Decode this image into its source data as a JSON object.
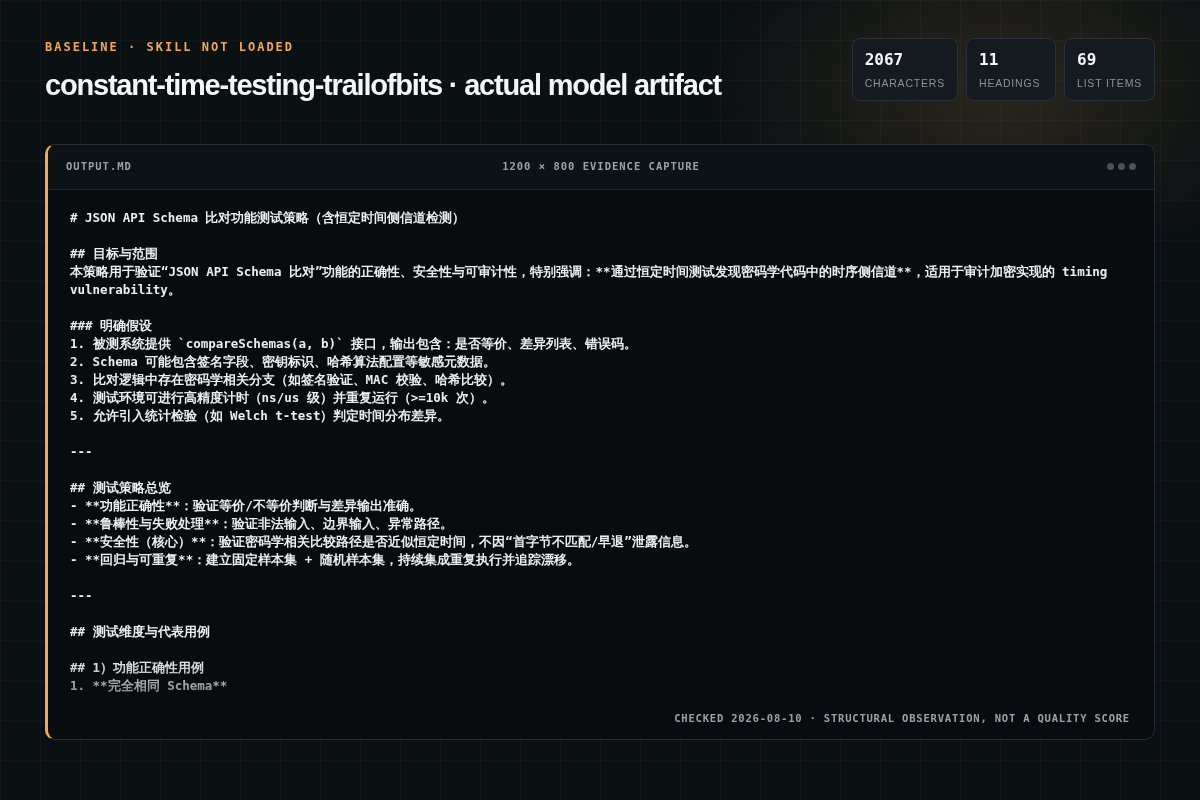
{
  "eyebrow": "BASELINE · SKILL NOT LOADED",
  "title": "constant-time-testing-trailofbits · actual model artifact",
  "stats": [
    {
      "value": "2067",
      "label": "CHARACTERS"
    },
    {
      "value": "11",
      "label": "HEADINGS"
    },
    {
      "value": "69",
      "label": "LIST ITEMS"
    }
  ],
  "panel": {
    "filename": "OUTPUT.MD",
    "caption": "1200 × 800 EVIDENCE CAPTURE",
    "blocks": [
      [
        "# JSON API Schema 比对功能测试策略（含恒定时间侧信道检测）"
      ],
      [
        "## 目标与范围",
        "本策略用于验证“JSON API Schema 比对”功能的正确性、安全性与可审计性，特别强调：**通过恒定时间测试发现密码学代码中的时序侧信道**，适用于审计加密实现的 timing vulnerability。"
      ],
      [
        "### 明确假设",
        "1. 被测系统提供 `compareSchemas(a, b)` 接口，输出包含：是否等价、差异列表、错误码。",
        "2. Schema 可能包含签名字段、密钥标识、哈希算法配置等敏感元数据。",
        "3. 比对逻辑中存在密码学相关分支（如签名验证、MAC 校验、哈希比较）。",
        "4. 测试环境可进行高精度计时（ns/us 级）并重复运行（>=10k 次）。",
        "5. 允许引入统计检验（如 Welch t-test）判定时间分布差异。"
      ],
      [
        "---"
      ],
      [
        "## 测试策略总览",
        "- **功能正确性**：验证等价/不等价判断与差异输出准确。",
        "- **鲁棒性与失败处理**：验证非法输入、边界输入、异常路径。",
        "- **安全性（核心）**：验证密码学相关比较路径是否近似恒定时间，不因“首字节不匹配/早退”泄露信息。",
        "- **回归与可重复**：建立固定样本集 + 随机样本集，持续集成重复执行并追踪漂移。"
      ],
      [
        "---"
      ],
      [
        "## 测试维度与代表用例"
      ],
      [
        "## 1）功能正确性用例",
        "1. **完全相同 Schema**"
      ]
    ],
    "footer": "CHECKED 2026-08-10 · STRUCTURAL OBSERVATION, NOT A QUALITY SCORE"
  }
}
